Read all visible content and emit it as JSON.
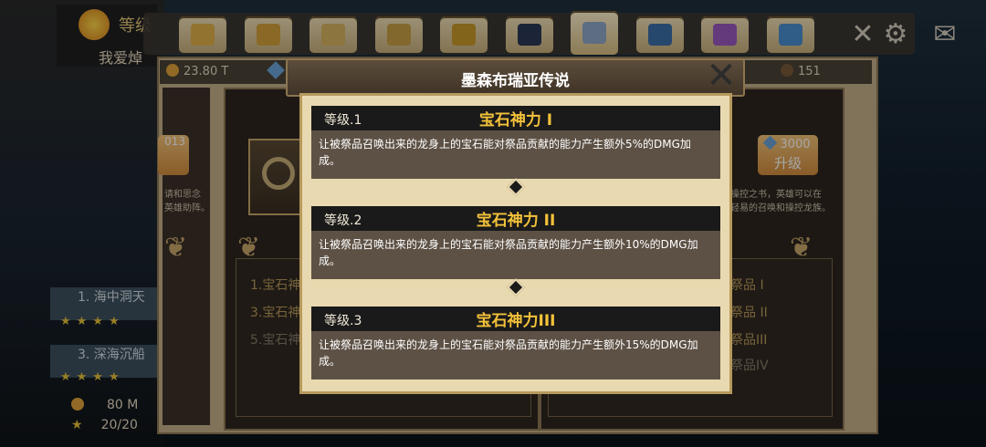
{
  "player": {
    "level_label": "等级",
    "name": "我爱焯"
  },
  "tabs": [
    {
      "icon": "hero-icon",
      "active": false
    },
    {
      "icon": "dragon-icon",
      "active": false
    },
    {
      "icon": "castle-icon",
      "active": false
    },
    {
      "icon": "ankh-icon",
      "active": false
    },
    {
      "icon": "trophy-icon",
      "active": false
    },
    {
      "icon": "orb-icon",
      "active": false
    },
    {
      "icon": "relic-icon",
      "active": true
    },
    {
      "icon": "gem-icon",
      "active": false
    },
    {
      "icon": "shirt-icon",
      "active": false
    },
    {
      "icon": "friends-icon",
      "active": false
    }
  ],
  "resources": {
    "gold": "23.80 T",
    "other": "151"
  },
  "upgrade": {
    "cost": "3000",
    "label": "升级"
  },
  "left_upgrade_cost": "013",
  "side_text_left": [
    "请和思念",
    "英雄助阵。"
  ],
  "side_text_right": [
    "操控之书，英雄可以在",
    "轻易的召唤和操控龙族。"
  ],
  "left_list": [
    "1.宝石神",
    "3.宝石神",
    "5.宝石神"
  ],
  "right_list": [
    "祭品 I",
    "祭品 II",
    "祭品III",
    "祭品IV"
  ],
  "rail": {
    "items": [
      "1. 海中洞天",
      "3. 深海沉船"
    ],
    "coins": "80 M",
    "stars": "20/20"
  },
  "dialog": {
    "title": "墨森布瑞亚传说",
    "entries": [
      {
        "level": "等级.1",
        "name": "宝石神力 I",
        "desc": "让被祭品召唤出来的龙身上的宝石能对祭品贡献的能力产生额外5%的DMG加成。"
      },
      {
        "level": "等级.2",
        "name": "宝石神力 II",
        "desc": "让被祭品召唤出来的龙身上的宝石能对祭品贡献的能力产生额外10%的DMG加成。"
      },
      {
        "level": "等级.3",
        "name": "宝石神力III",
        "desc": "让被祭品召唤出来的龙身上的宝石能对祭品贡献的能力产生额外15%的DMG加成。"
      }
    ]
  }
}
